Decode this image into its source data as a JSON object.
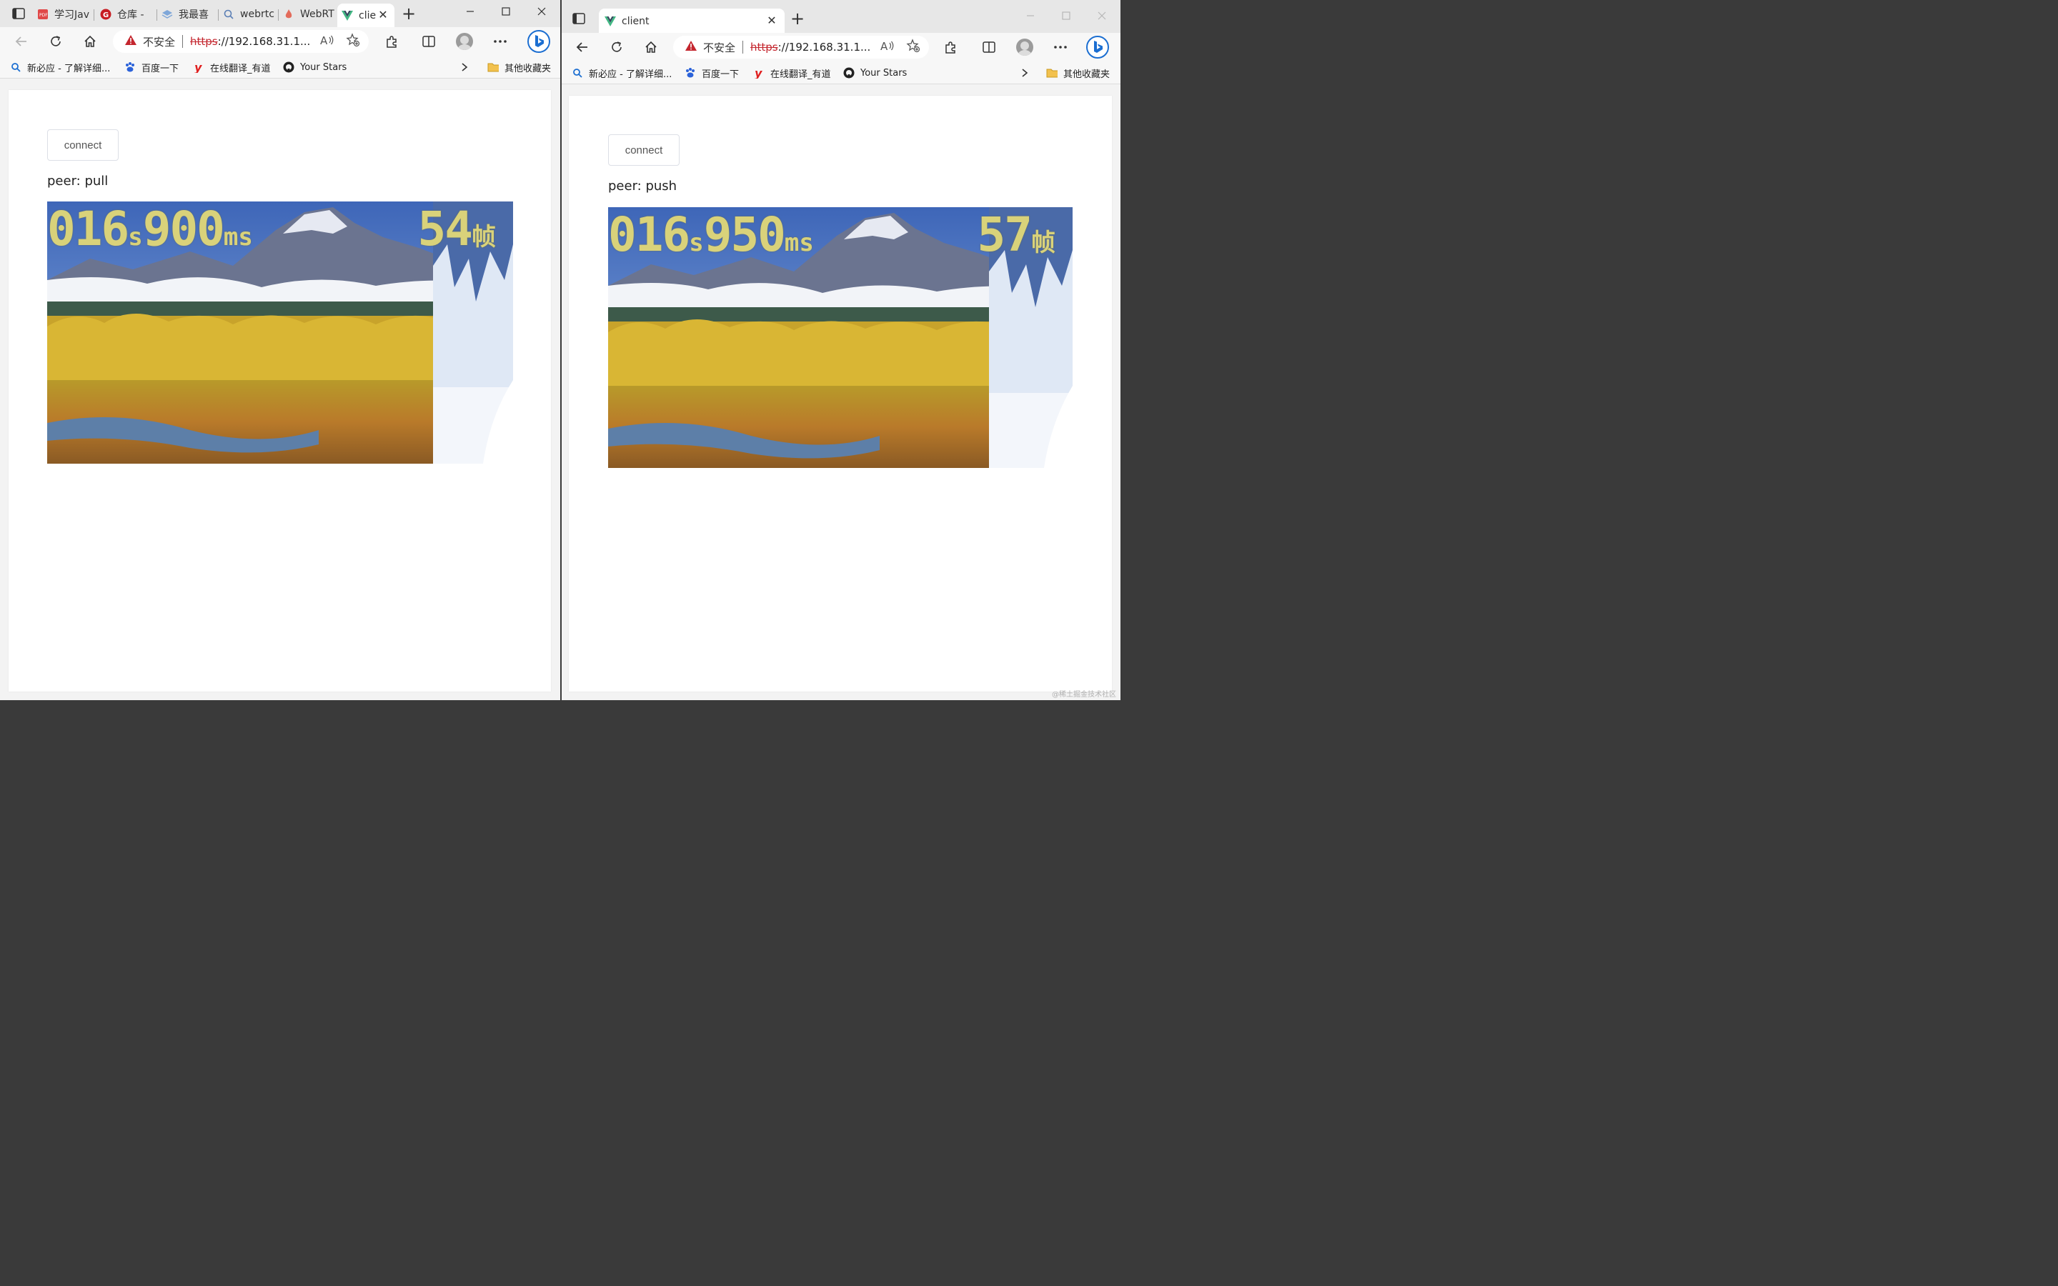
{
  "left": {
    "tabs": [
      {
        "label": "学习Jav"
      },
      {
        "label": "仓库 - "
      },
      {
        "label": "我最喜"
      },
      {
        "label": "webrtc"
      },
      {
        "label": "WebRT"
      },
      {
        "label": "clie"
      }
    ],
    "address": {
      "insecure": "不安全",
      "scheme": "https",
      "rest": "://192.168.31.1..."
    },
    "bookmarks": {
      "item1": "新必应 - 了解详细...",
      "item2": "百度一下",
      "item3": "在线翻译_有道",
      "item4": "Your Stars",
      "folder": "其他收藏夹"
    },
    "page": {
      "connect_label": "connect",
      "peer_label": "peer: pull",
      "video": {
        "time_digits1": "016",
        "time_unit1": "s",
        "time_digits2": "900",
        "time_unit2": "ms",
        "fps_value": "54",
        "fps_unit": "帧"
      }
    }
  },
  "right": {
    "tab": {
      "label": "client"
    },
    "address": {
      "insecure": "不安全",
      "scheme": "https",
      "rest": "://192.168.31.1..."
    },
    "bookmarks": {
      "item1": "新必应 - 了解详细...",
      "item2": "百度一下",
      "item3": "在线翻译_有道",
      "item4": "Your Stars",
      "folder": "其他收藏夹"
    },
    "page": {
      "connect_label": "connect",
      "peer_label": "peer: push",
      "video": {
        "time_digits1": "016",
        "time_unit1": "s",
        "time_digits2": "950",
        "time_unit2": "ms",
        "fps_value": "57",
        "fps_unit": "帧"
      }
    }
  },
  "watermark": "@稀土掘金技术社区",
  "colors": {
    "vue_green": "#41b883",
    "warning_red": "#c4262e",
    "overlay_text": "#d9d27a",
    "bing_blue": "#1b6ed1"
  }
}
